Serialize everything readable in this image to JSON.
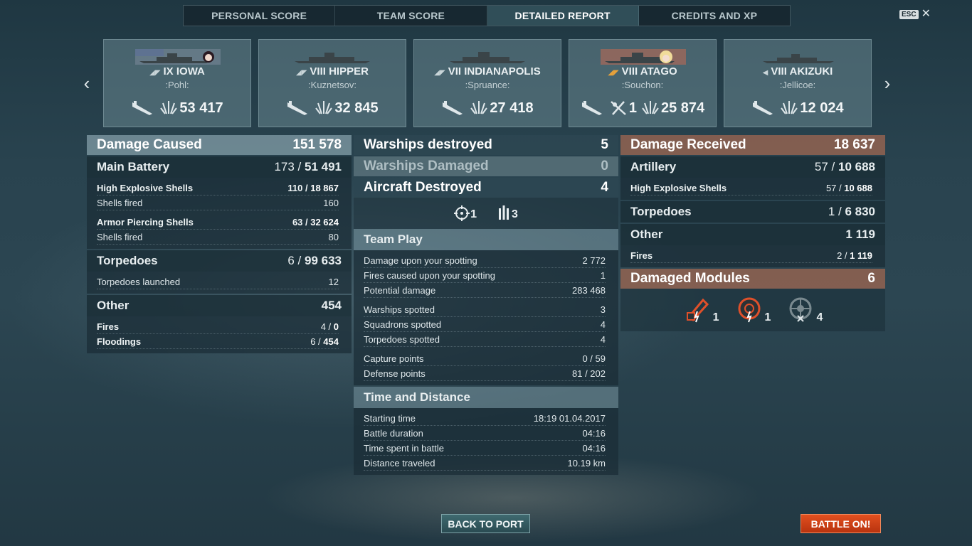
{
  "tabs": [
    "PERSONAL SCORE",
    "TEAM SCORE",
    "DETAILED REPORT",
    "CREDITS AND XP"
  ],
  "esc": {
    "key": "ESC",
    "close": "✕"
  },
  "nav": {
    "prev": "‹",
    "next": "›"
  },
  "ships": [
    {
      "name": "IX IOWA",
      "player": ":Pohl:",
      "stats": [
        "53 417"
      ]
    },
    {
      "name": "VIII HIPPER",
      "player": ":Kuznetsov:",
      "stats": [
        "32 845"
      ]
    },
    {
      "name": "VII INDIANAPOLIS",
      "player": ":Spruance:",
      "stats": [
        "27 418"
      ]
    },
    {
      "name": "VIII ATAGO",
      "player": ":Souchon:",
      "planes": "1",
      "stats": [
        "25 874"
      ]
    },
    {
      "name": "VIII AKIZUKI",
      "player": ":Jellicoe:",
      "stats": [
        "12 024"
      ]
    }
  ],
  "damage_caused": {
    "title": "Damage Caused",
    "total": "151 578",
    "main_battery": {
      "label": "Main Battery",
      "hits": "173 / ",
      "dmg": "51 491"
    },
    "he": {
      "label": "High Explosive Shells",
      "hits": "110 / ",
      "dmg": "18 867",
      "fired_label": "Shells fired",
      "fired": "160"
    },
    "ap": {
      "label": "Armor Piercing Shells",
      "hits": "63 / ",
      "dmg": "32 624",
      "fired_label": "Shells fired",
      "fired": "80"
    },
    "torpedoes": {
      "label": "Torpedoes",
      "hits": "6 / ",
      "dmg": "99 633",
      "launched_label": "Torpedoes launched",
      "launched": "12"
    },
    "other": {
      "label": "Other",
      "total": "454"
    },
    "fires": {
      "label": "Fires",
      "hits": "4 / ",
      "dmg": "0"
    },
    "floodings": {
      "label": "Floodings",
      "hits": "6 / ",
      "dmg": "454"
    }
  },
  "middle": {
    "warships_destroyed": {
      "label": "Warships destroyed",
      "value": "5"
    },
    "warships_damaged": {
      "label": "Warships Damaged",
      "value": "0"
    },
    "aircraft_destroyed": {
      "label": "Aircraft Destroyed",
      "value": "4"
    },
    "aircraft_icons": {
      "target": "1",
      "planes": "3"
    },
    "team_play": {
      "title": "Team Play",
      "rows1": [
        {
          "label": "Damage upon your spotting",
          "value": "2 772"
        },
        {
          "label": "Fires caused upon your spotting",
          "value": "1"
        },
        {
          "label": "Potential damage",
          "value": "283 468"
        }
      ],
      "rows2": [
        {
          "label": "Warships spotted",
          "value": "3"
        },
        {
          "label": "Squadrons spotted",
          "value": "4"
        },
        {
          "label": "Torpedoes spotted",
          "value": "4"
        }
      ],
      "rows3": [
        {
          "label": "Capture points",
          "value": "0 / 59"
        },
        {
          "label": "Defense points",
          "value": "81 / 202"
        }
      ]
    },
    "time_distance": {
      "title": "Time and Distance",
      "rows": [
        {
          "label": "Starting time",
          "value": "18:19  01.04.2017"
        },
        {
          "label": "Battle duration",
          "value": "04:16"
        },
        {
          "label": "Time spent in battle",
          "value": "04:16"
        },
        {
          "label": "Distance traveled",
          "value": "10.19 km"
        }
      ]
    }
  },
  "damage_received": {
    "title": "Damage Received",
    "total": "18 637",
    "artillery": {
      "label": "Artillery",
      "hits": "57 / ",
      "dmg": "10 688"
    },
    "he": {
      "label": "High Explosive Shells",
      "hits": "57 / ",
      "dmg": "10 688"
    },
    "torpedoes": {
      "label": "Torpedoes",
      "hits": "1 / ",
      "dmg": "6 830"
    },
    "other": {
      "label": "Other",
      "total": "1 119"
    },
    "fires": {
      "label": "Fires",
      "hits": "2 / ",
      "dmg": "1 119"
    },
    "modules": {
      "title": "Damaged Modules",
      "total": "6",
      "items": [
        {
          "icon": "gun-module-icon",
          "count": "1"
        },
        {
          "icon": "engine-module-icon",
          "count": "1"
        },
        {
          "icon": "steering-module-icon",
          "count": "4"
        }
      ]
    }
  },
  "buttons": {
    "back": "BACK TO PORT",
    "battle": "BATTLE ON!"
  },
  "colors": {
    "accent_orange": "#d4431a",
    "header_brown": "#966450",
    "active_tab": "#466e78"
  }
}
